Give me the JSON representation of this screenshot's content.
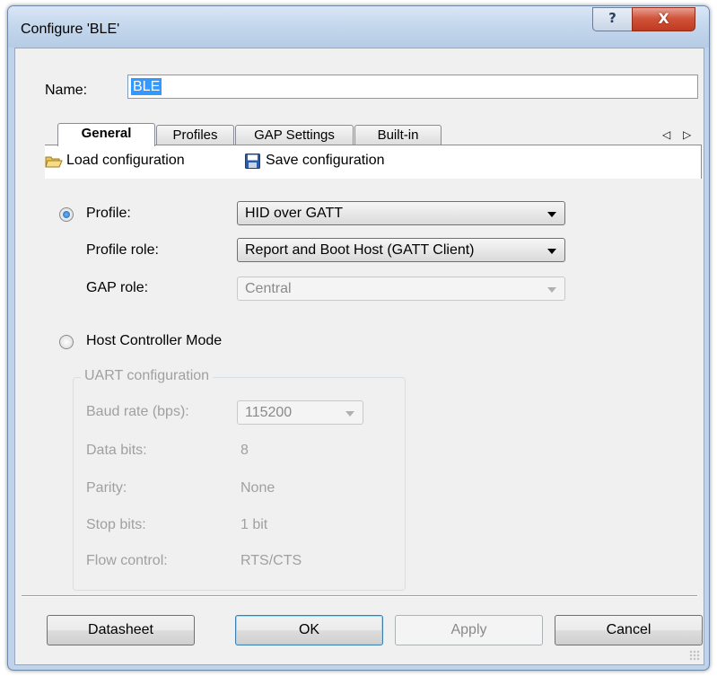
{
  "window": {
    "title": "Configure 'BLE'",
    "help_glyph": "?",
    "close_glyph": "X"
  },
  "name": {
    "label": "Name:",
    "value": "BLE"
  },
  "tabs": [
    {
      "label": "General",
      "active": true
    },
    {
      "label": "Profiles",
      "active": false
    },
    {
      "label": "GAP Settings",
      "active": false
    },
    {
      "label": "Built-in",
      "active": false
    }
  ],
  "tab_scroll": "◁ ▷",
  "toolbar": {
    "load_label": "Load configuration",
    "save_label": "Save configuration"
  },
  "profile_mode": {
    "label": "Profile:",
    "checked": true,
    "profile_value": "HID over GATT",
    "role_label": "Profile role:",
    "role_value": "Report and Boot Host (GATT Client)",
    "gap_label": "GAP role:",
    "gap_value": "Central"
  },
  "host_mode": {
    "label": "Host Controller Mode",
    "checked": false
  },
  "uart": {
    "title": "UART configuration",
    "baud_label": "Baud rate (bps):",
    "baud_value": "115200",
    "data_label": "Data bits:",
    "data_value": "8",
    "parity_label": "Parity:",
    "parity_value": "None",
    "stop_label": "Stop bits:",
    "stop_value": "1 bit",
    "flow_label": "Flow control:",
    "flow_value": "RTS/CTS"
  },
  "buttons": {
    "datasheet": "Datasheet",
    "ok": "OK",
    "apply": "Apply",
    "cancel": "Cancel"
  },
  "colors": {
    "selection": "#3399ff",
    "title_bar": "#c3d6ec",
    "close_button": "#c0391f",
    "disabled_text": "#a0a0a0"
  }
}
